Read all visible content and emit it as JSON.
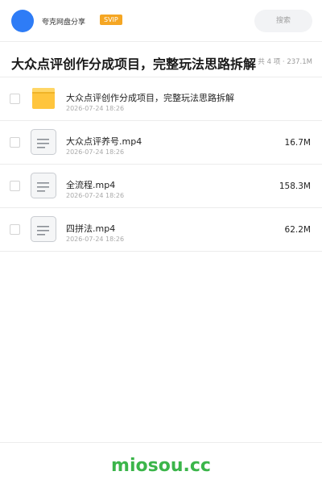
{
  "header": {
    "share_name": "夸克网盘分享",
    "badge": "SVIP",
    "search_placeholder": "搜索"
  },
  "folder": {
    "title": "大众点评创作分成项目，完整玩法思路拆解",
    "summary": "共 4 项 · 237.1M"
  },
  "files": [
    {
      "type": "folder",
      "icon": "folder-icon",
      "name": "大众点评创作分成项目，完整玩法思路拆解",
      "date": "2026-07-24 18:26",
      "size": ""
    },
    {
      "type": "video",
      "icon": "file-icon",
      "name": "大众点评养号.mp4",
      "date": "2026-07-24 18:26",
      "size": "16.7M"
    },
    {
      "type": "video",
      "icon": "file-icon",
      "name": "全流程.mp4",
      "date": "2026-07-24 18:26",
      "size": "158.3M"
    },
    {
      "type": "video",
      "icon": "file-icon",
      "name": "四拼法.mp4",
      "date": "2026-07-24 18:26",
      "size": "62.2M"
    }
  ],
  "footer": {
    "watermark": "miosou.cc"
  },
  "colors": {
    "accent": "#2e7cf6",
    "svip": "#f5a623",
    "folder": "#ffc53d",
    "watermark": "#3bb54a"
  }
}
